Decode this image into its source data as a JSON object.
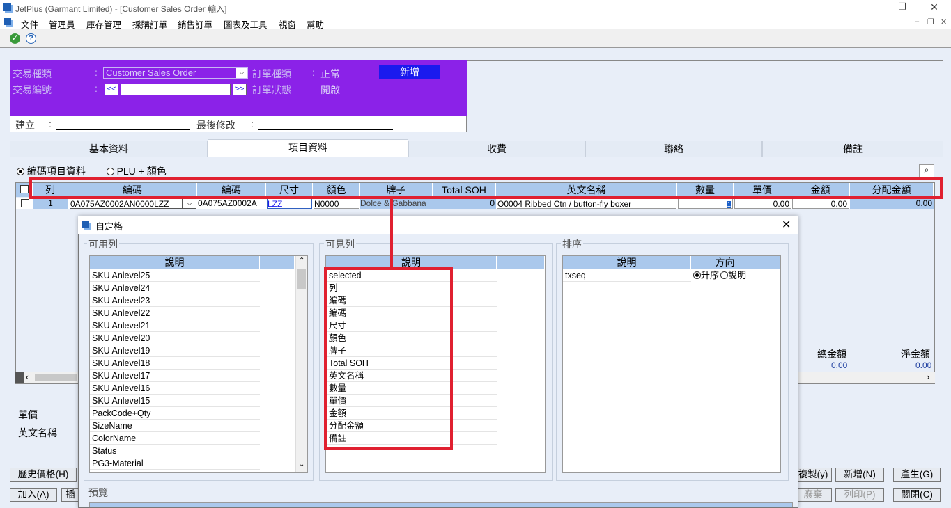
{
  "window": {
    "title": "JetPlus (Garmant Limited) - [Customer Sales Order 輸入]",
    "minimize": "—",
    "restore": "❐",
    "close": "✕"
  },
  "menu": [
    "文件",
    "管理員",
    "庫存管理",
    "採購訂單",
    "銷售訂單",
    "圖表及工具",
    "視窗",
    "幫助"
  ],
  "mdi_controls": [
    "–",
    "❐",
    "✕"
  ],
  "header": {
    "txn_type_label": "交易種類",
    "txn_type_value": "Customer Sales Order",
    "txn_no_label": "交易編號",
    "txn_no_prev": "<<",
    "txn_no_next": ">>",
    "txn_no_value": "",
    "order_type_label": "訂單種類",
    "order_type_value": "正常",
    "order_status_label": "訂單狀態",
    "order_status_value": "開啟",
    "mode_badge": "新增",
    "create_label": "建立",
    "colon": ":",
    "modified_label": "最後修改"
  },
  "tabs": [
    "基本資料",
    "項目資料",
    "收費",
    "聯絡",
    "備註"
  ],
  "active_tab": 1,
  "radio": {
    "opt1": "編碼項目資料",
    "opt2": "PLU + 顏色"
  },
  "grid": {
    "headers": [
      "列",
      "編碼",
      "編碼",
      "尺寸",
      "顏色",
      "牌子",
      "Total SOH",
      "英文名稱",
      "數量",
      "單價",
      "金額",
      "分配金額"
    ],
    "row": [
      "1",
      "0A075AZ0002AN0000LZZ",
      "0A075AZ0002A",
      "LZZ",
      "N0000",
      "Dolce & Gabbana",
      "0",
      "O0004   Ribbed Ctn / button-fly boxer",
      "1",
      "0.00",
      "0.00",
      "0.00"
    ]
  },
  "totals": {
    "gross_label": "總金額",
    "gross_value": "0.00",
    "net_label": "淨金額",
    "net_value": "0.00"
  },
  "left_labels": {
    "unit_price": "單價",
    "eng_name": "英文名稱"
  },
  "buttons": {
    "history": "歷史價格(H)",
    "add": "加入(A)",
    "insert": "插",
    "copy": "複製(y)",
    "new": "新增(N)",
    "generate": "產生(G)",
    "void": "廢棄",
    "print": "列印(P)",
    "close": "關閉(C)"
  },
  "dialog": {
    "title": "自定格",
    "available_label": "可用列",
    "visible_label": "可見列",
    "sort_label": "排序",
    "preview_label": "預覽",
    "desc_header": "說明",
    "dir_header": "方向",
    "available": [
      "SKU Anlevel25",
      "SKU Anlevel24",
      "SKU Anlevel23",
      "SKU Anlevel22",
      "SKU Anlevel21",
      "SKU Anlevel20",
      "SKU Anlevel19",
      "SKU Anlevel18",
      "SKU Anlevel17",
      "SKU Anlevel16",
      "SKU Anlevel15",
      "PackCode+Qty",
      "SizeName",
      "ColorName",
      "Status",
      "PG3-Material"
    ],
    "visible": [
      "selected",
      "列",
      "編碼",
      "編碼",
      "尺寸",
      "顏色",
      "牌子",
      "Total SOH",
      "英文名稱",
      "數量",
      "單價",
      "金額",
      "分配金額",
      "備註"
    ],
    "sort": {
      "field": "txseq",
      "asc": "升序",
      "desc": "說明"
    }
  },
  "colors": {
    "accent_purple": "#8b22e8",
    "header_blue": "#aac8ec",
    "highlight_red": "#e02030",
    "mode_blue": "#1a1aee"
  }
}
